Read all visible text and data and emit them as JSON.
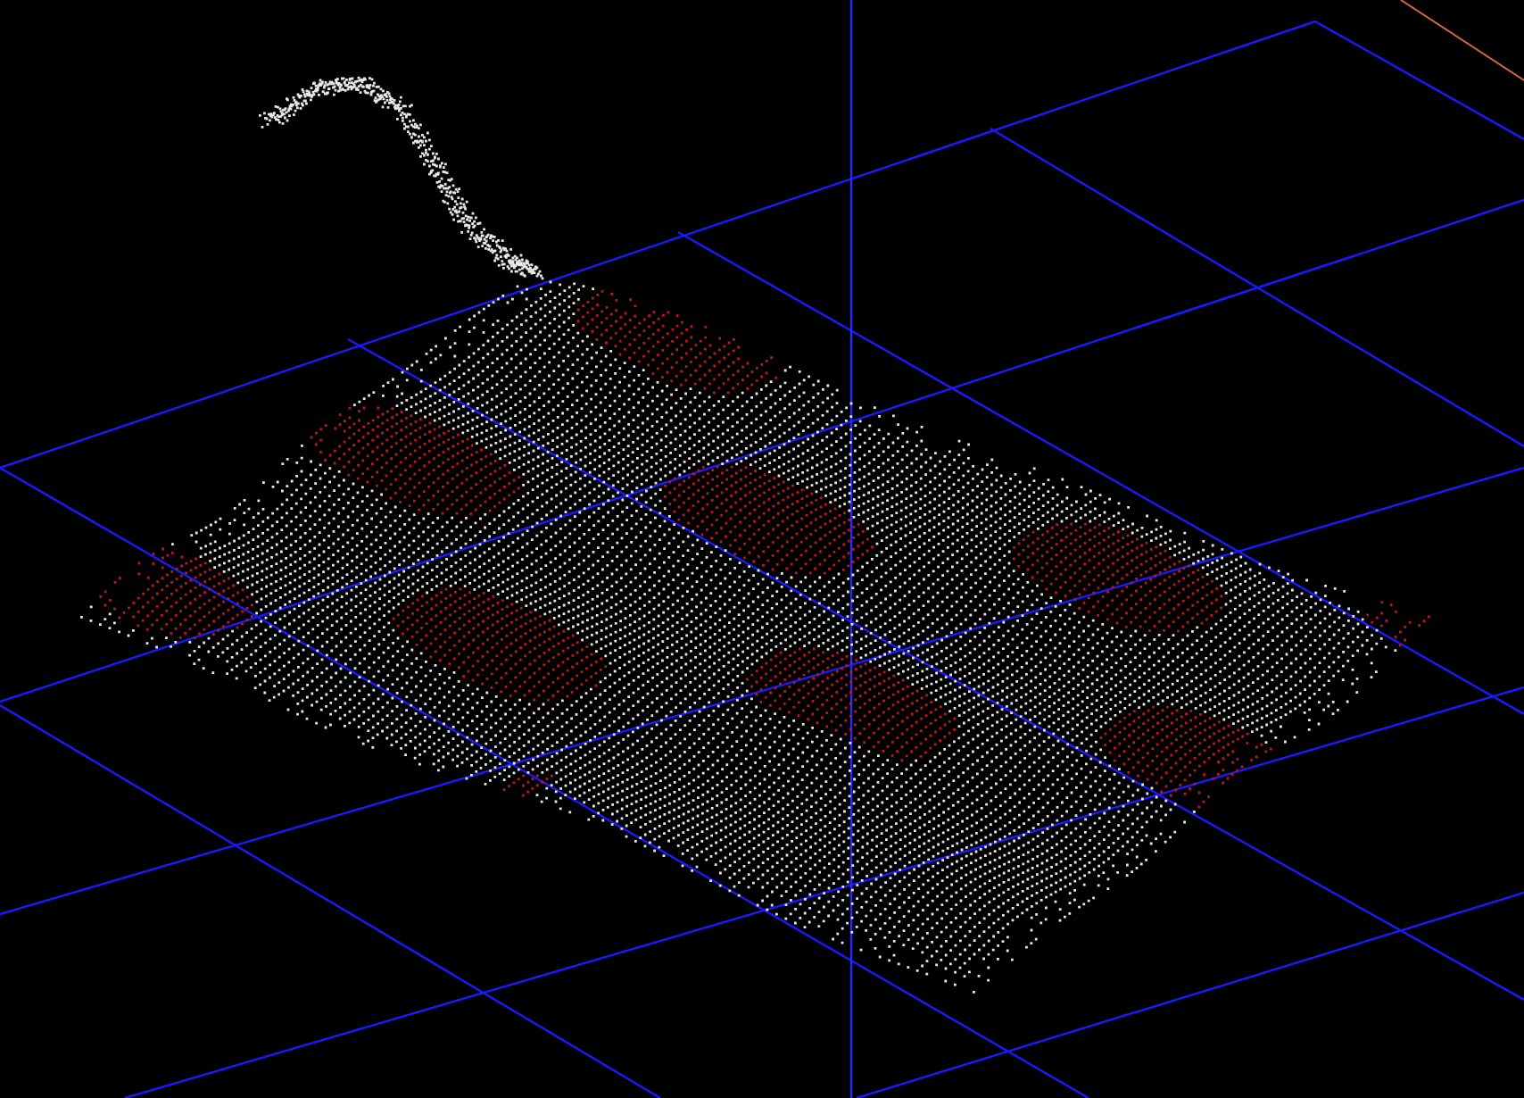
{
  "viewport": {
    "grid_visible": true,
    "axes_visible": true,
    "point_cloud_visible": true
  }
}
